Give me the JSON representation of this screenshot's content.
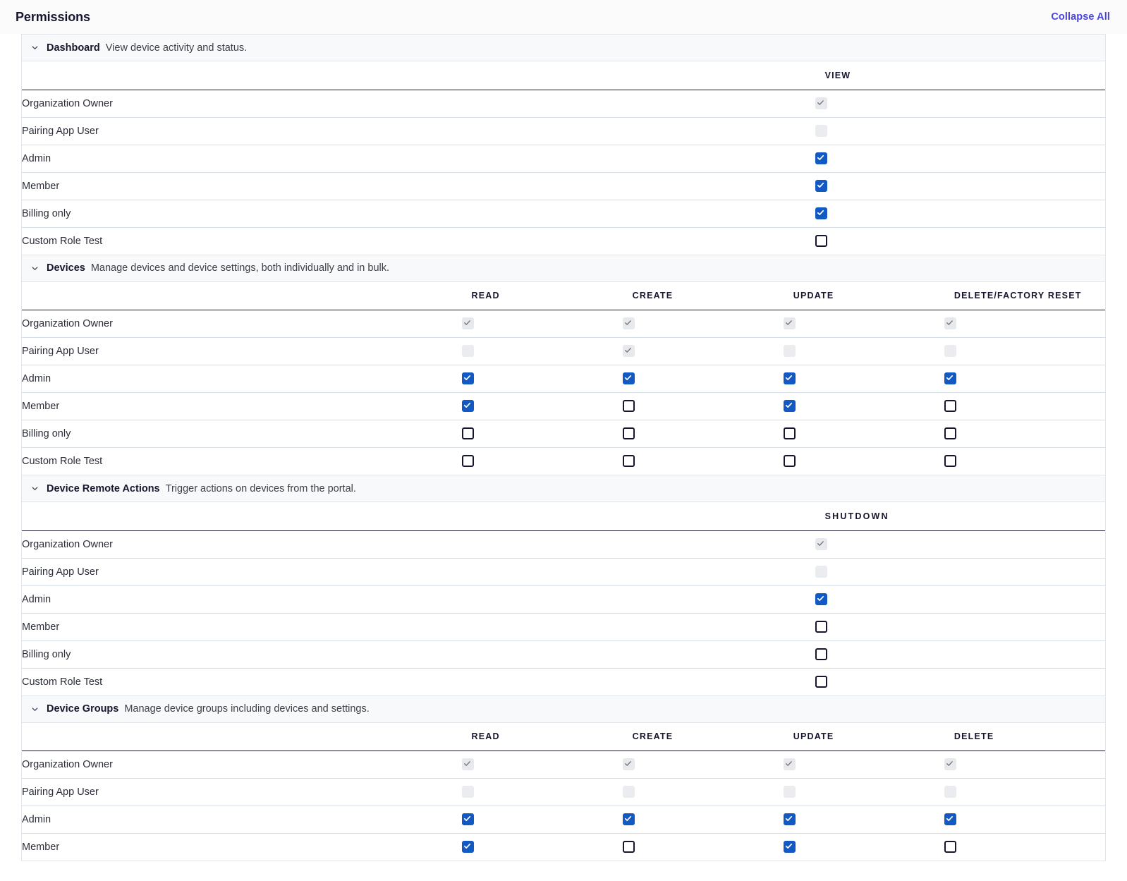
{
  "header": {
    "title": "Permissions",
    "collapse_all_label": "Collapse All"
  },
  "icons": {
    "chevron_down": "chevron-down-icon",
    "check": "check-icon"
  },
  "colors": {
    "link": "#4a44e0",
    "checkbox_checked": "#1259c3",
    "checkbox_border": "#16162e",
    "checkbox_disabled_bg": "#eaecef",
    "checkbox_disabled_check": "#73777e",
    "section_header_bg": "#f8f9fa",
    "row_border": "#d7dde4",
    "text": "#16162e"
  },
  "roles": [
    "Organization Owner",
    "Pairing App User",
    "Admin",
    "Member",
    "Billing only",
    "Custom Role Test"
  ],
  "sections": [
    {
      "name": "Dashboard",
      "description": "View device activity and status.",
      "expanded": true,
      "columns": [
        "VIEW"
      ],
      "wide_letter_spacing": false,
      "rows": [
        {
          "role": "Organization Owner",
          "cells": [
            {
              "checked": true,
              "disabled": true
            }
          ]
        },
        {
          "role": "Pairing App User",
          "cells": [
            {
              "checked": false,
              "disabled": true
            }
          ]
        },
        {
          "role": "Admin",
          "cells": [
            {
              "checked": true,
              "disabled": false
            }
          ]
        },
        {
          "role": "Member",
          "cells": [
            {
              "checked": true,
              "disabled": false
            }
          ]
        },
        {
          "role": "Billing only",
          "cells": [
            {
              "checked": true,
              "disabled": false
            }
          ]
        },
        {
          "role": "Custom Role Test",
          "cells": [
            {
              "checked": false,
              "disabled": false
            }
          ]
        }
      ]
    },
    {
      "name": "Devices",
      "description": "Manage devices and device settings, both individually and in bulk.",
      "expanded": true,
      "columns": [
        "READ",
        "CREATE",
        "UPDATE",
        "DELETE/FACTORY RESET"
      ],
      "wide_letter_spacing": false,
      "rows": [
        {
          "role": "Organization Owner",
          "cells": [
            {
              "checked": true,
              "disabled": true
            },
            {
              "checked": true,
              "disabled": true
            },
            {
              "checked": true,
              "disabled": true
            },
            {
              "checked": true,
              "disabled": true
            }
          ]
        },
        {
          "role": "Pairing App User",
          "cells": [
            {
              "checked": false,
              "disabled": true
            },
            {
              "checked": true,
              "disabled": true
            },
            {
              "checked": false,
              "disabled": true
            },
            {
              "checked": false,
              "disabled": true
            }
          ]
        },
        {
          "role": "Admin",
          "cells": [
            {
              "checked": true,
              "disabled": false
            },
            {
              "checked": true,
              "disabled": false
            },
            {
              "checked": true,
              "disabled": false
            },
            {
              "checked": true,
              "disabled": false
            }
          ]
        },
        {
          "role": "Member",
          "cells": [
            {
              "checked": true,
              "disabled": false
            },
            {
              "checked": false,
              "disabled": false
            },
            {
              "checked": true,
              "disabled": false
            },
            {
              "checked": false,
              "disabled": false
            }
          ]
        },
        {
          "role": "Billing only",
          "cells": [
            {
              "checked": false,
              "disabled": false
            },
            {
              "checked": false,
              "disabled": false
            },
            {
              "checked": false,
              "disabled": false
            },
            {
              "checked": false,
              "disabled": false
            }
          ]
        },
        {
          "role": "Custom Role Test",
          "cells": [
            {
              "checked": false,
              "disabled": false
            },
            {
              "checked": false,
              "disabled": false
            },
            {
              "checked": false,
              "disabled": false
            },
            {
              "checked": false,
              "disabled": false
            }
          ]
        }
      ]
    },
    {
      "name": "Device Remote Actions",
      "description": "Trigger actions on devices from the portal.",
      "expanded": true,
      "columns": [
        "SHUTDOWN"
      ],
      "wide_letter_spacing": true,
      "rows": [
        {
          "role": "Organization Owner",
          "cells": [
            {
              "checked": true,
              "disabled": true
            }
          ]
        },
        {
          "role": "Pairing App User",
          "cells": [
            {
              "checked": false,
              "disabled": true
            }
          ]
        },
        {
          "role": "Admin",
          "cells": [
            {
              "checked": true,
              "disabled": false
            }
          ]
        },
        {
          "role": "Member",
          "cells": [
            {
              "checked": false,
              "disabled": false
            }
          ]
        },
        {
          "role": "Billing only",
          "cells": [
            {
              "checked": false,
              "disabled": false
            }
          ]
        },
        {
          "role": "Custom Role Test",
          "cells": [
            {
              "checked": false,
              "disabled": false
            }
          ]
        }
      ]
    },
    {
      "name": "Device Groups",
      "description": "Manage device groups including devices and settings.",
      "expanded": true,
      "columns": [
        "READ",
        "CREATE",
        "UPDATE",
        "DELETE"
      ],
      "wide_letter_spacing": false,
      "rows": [
        {
          "role": "Organization Owner",
          "cells": [
            {
              "checked": true,
              "disabled": true
            },
            {
              "checked": true,
              "disabled": true
            },
            {
              "checked": true,
              "disabled": true
            },
            {
              "checked": true,
              "disabled": true
            }
          ]
        },
        {
          "role": "Pairing App User",
          "cells": [
            {
              "checked": false,
              "disabled": true
            },
            {
              "checked": false,
              "disabled": true
            },
            {
              "checked": false,
              "disabled": true
            },
            {
              "checked": false,
              "disabled": true
            }
          ]
        },
        {
          "role": "Admin",
          "cells": [
            {
              "checked": true,
              "disabled": false
            },
            {
              "checked": true,
              "disabled": false
            },
            {
              "checked": true,
              "disabled": false
            },
            {
              "checked": true,
              "disabled": false
            }
          ]
        },
        {
          "role": "Member",
          "cells": [
            {
              "checked": true,
              "disabled": false
            },
            {
              "checked": false,
              "disabled": false
            },
            {
              "checked": true,
              "disabled": false
            },
            {
              "checked": false,
              "disabled": false
            }
          ]
        }
      ]
    }
  ]
}
